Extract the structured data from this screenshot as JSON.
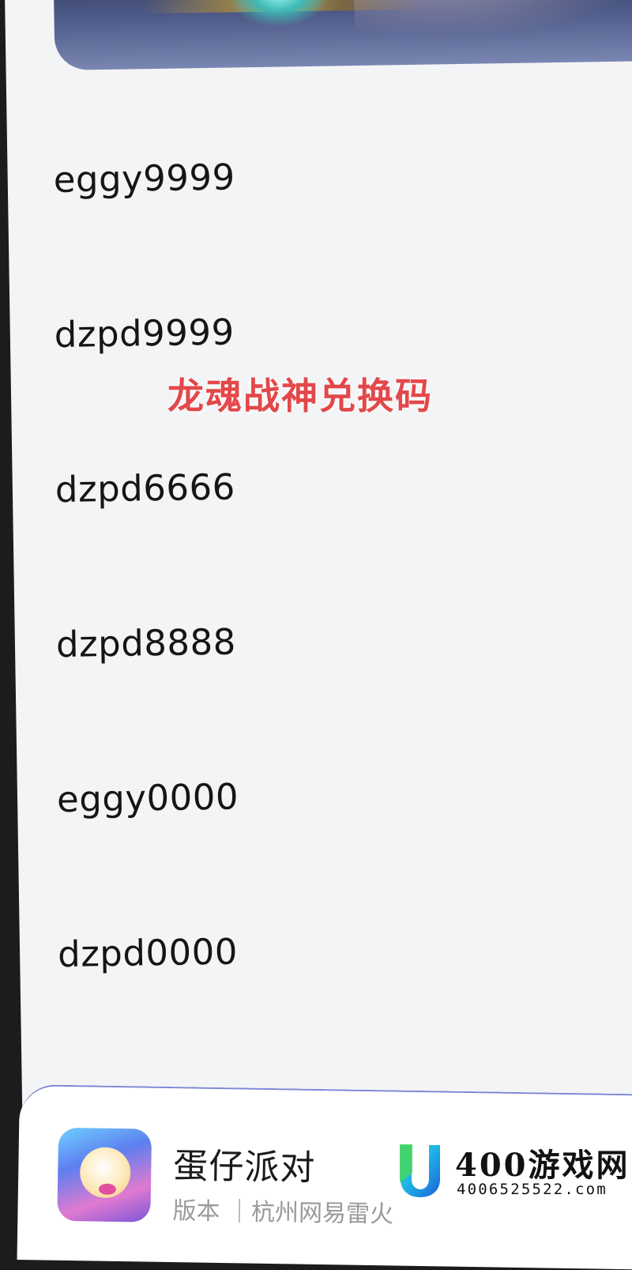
{
  "codes": [
    "eggy9999",
    "dzpd9999",
    "dzpd6666",
    "dzpd8888",
    "eggy0000",
    "dzpd0000"
  ],
  "overlay_title": "龙魂战神兑换码",
  "overlay_title_color": "#e3484a",
  "app_card": {
    "icon": "app-icon",
    "name": "蛋仔派对",
    "meta": "版本 ｜杭州网易雷火"
  },
  "watermark": {
    "main": "400游戏网",
    "sub": "4006525522.com",
    "logo": "u-logo-icon"
  }
}
